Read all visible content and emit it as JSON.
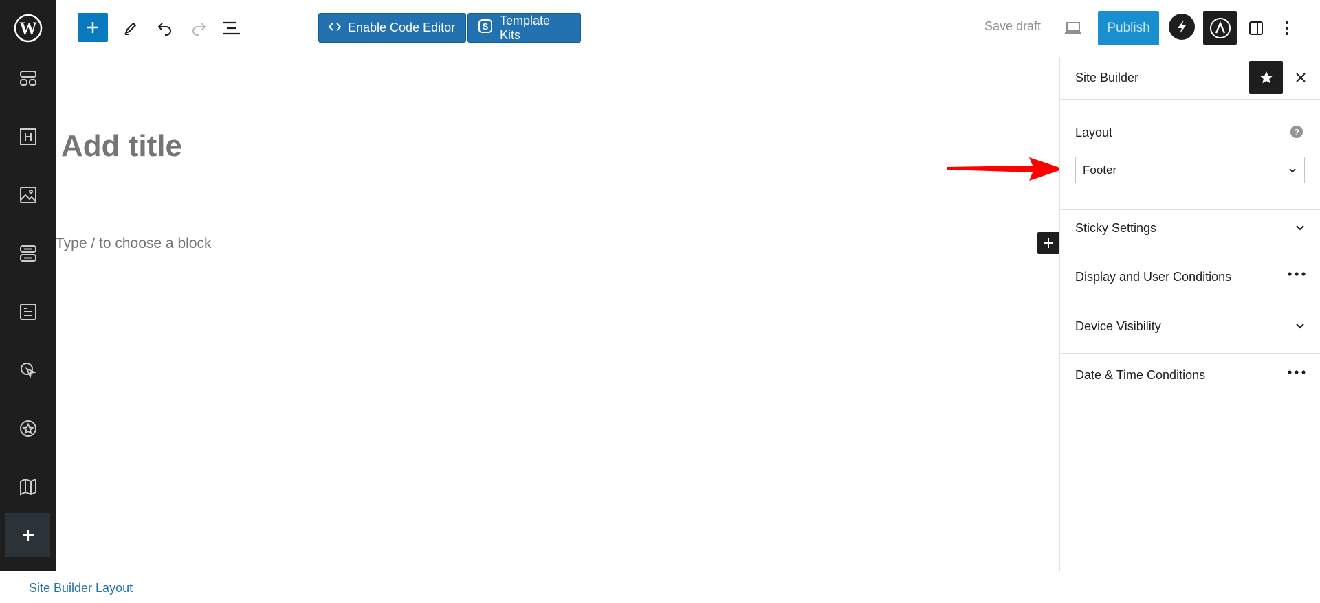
{
  "toolbar": {
    "enable_code_editor": "Enable Code Editor",
    "template_kits": "Template Kits",
    "save_draft": "Save draft",
    "publish": "Publish"
  },
  "editor": {
    "title_placeholder": "Add title",
    "block_placeholder": "Type / to choose a block"
  },
  "sidebar": {
    "title": "Site Builder",
    "layout_label": "Layout",
    "layout_value": "Footer",
    "panels": [
      {
        "label": "Sticky Settings",
        "control": "chevron-down"
      },
      {
        "label": "Display and User Conditions",
        "control": "more"
      },
      {
        "label": "Device Visibility",
        "control": "chevron-down"
      },
      {
        "label": "Date & Time Conditions",
        "control": "more"
      }
    ]
  },
  "footer": {
    "breadcrumb": "Site Builder Layout"
  },
  "colors": {
    "admin_bar": "#1e1e1e",
    "primary_blue": "#2271b1",
    "publish_blue": "#1a8fd0",
    "annotation_red": "#ff0000"
  },
  "icons": {
    "admin_sidebar": [
      "wordpress-logo-icon",
      "layout-icon",
      "heading-icon",
      "image-icon",
      "section-icon",
      "post-icon",
      "cursor-icon",
      "star-circle-icon",
      "map-icon",
      "plus-icon"
    ]
  }
}
